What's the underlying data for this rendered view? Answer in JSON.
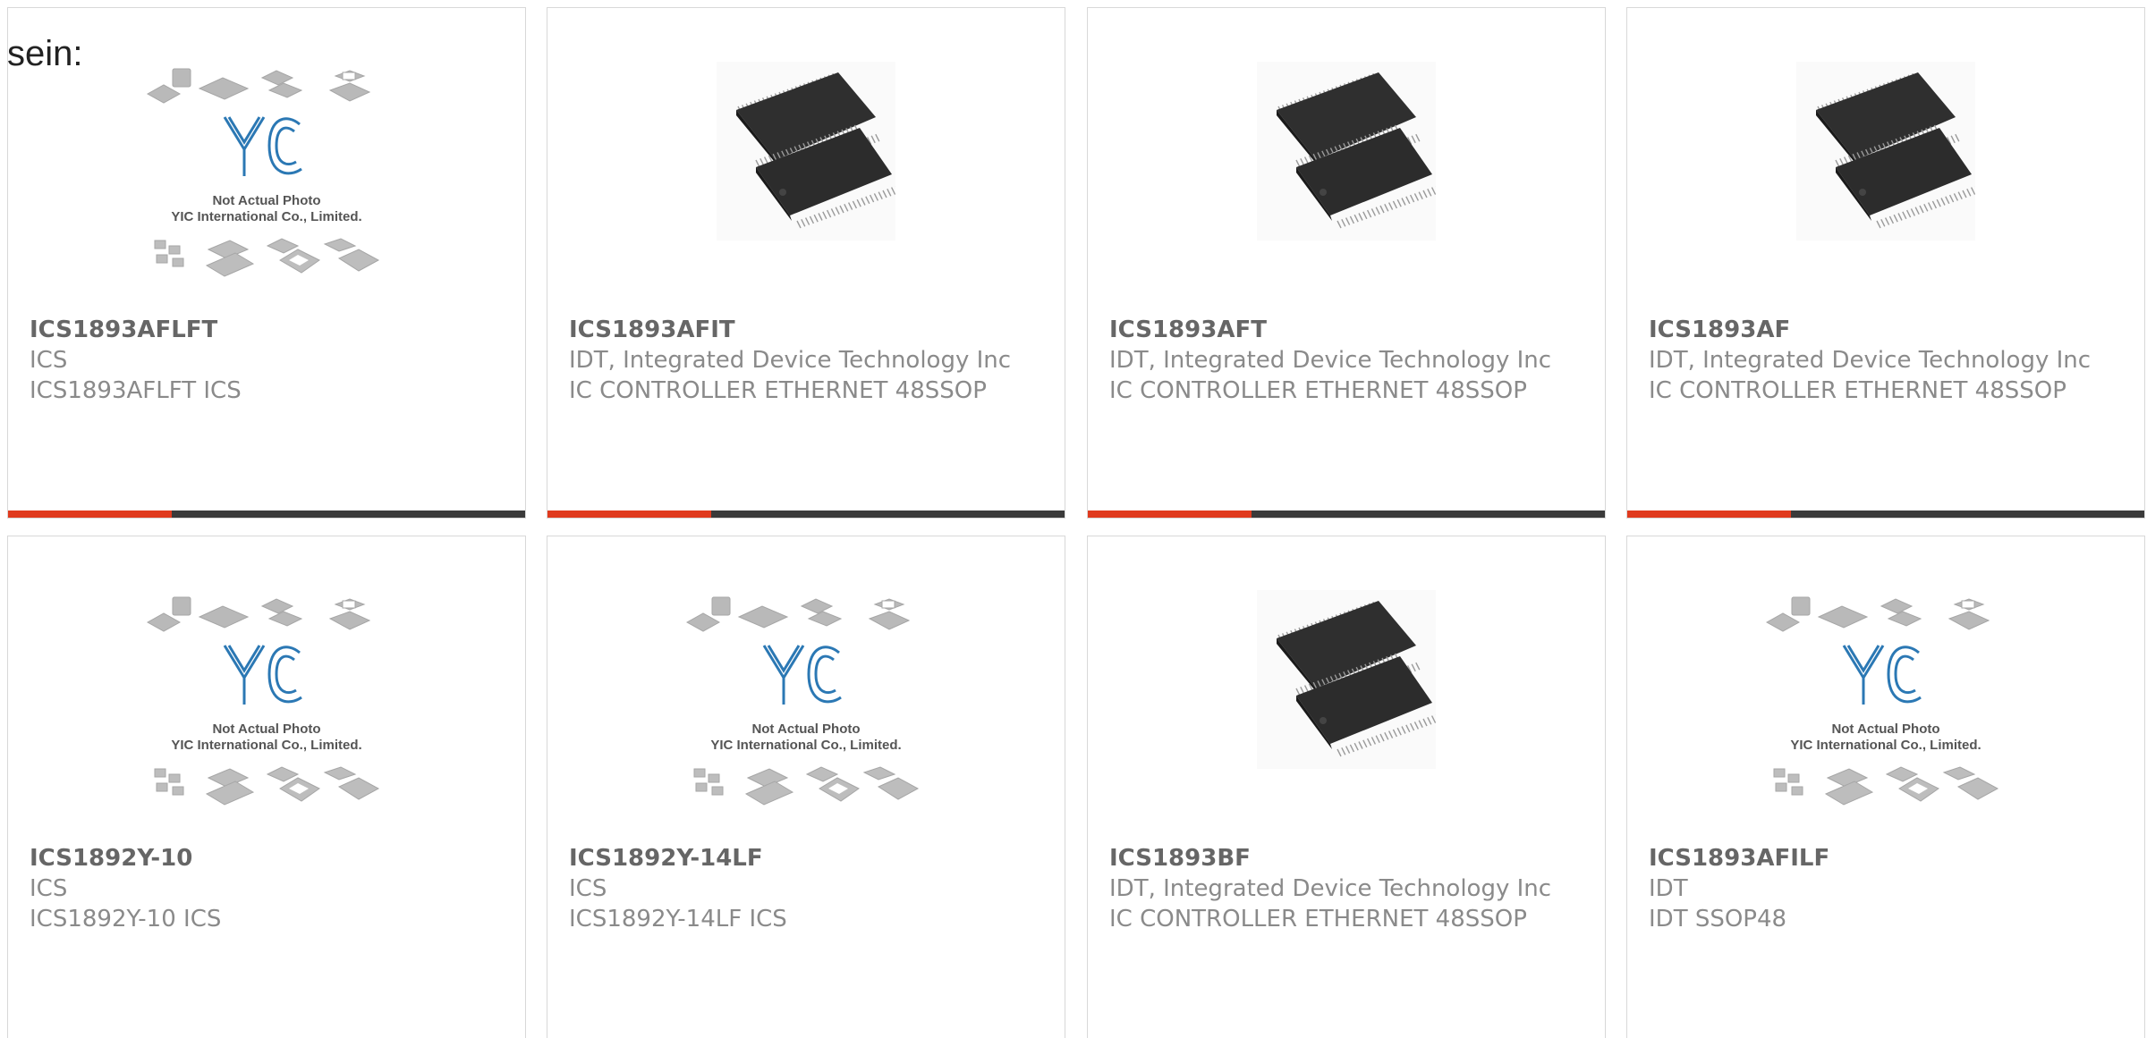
{
  "intro": "sein:",
  "colors": {
    "accent": "#e03a1e",
    "bar": "#3a3a3a",
    "logo_blue": "#2b78b4"
  },
  "placeholder_image": {
    "line1": "Not Actual Photo",
    "line2": "YIC International Co., Limited."
  },
  "products": [
    {
      "part": "ICS1893AFLFT",
      "maker": "ICS",
      "desc": "ICS1893AFLFT ICS",
      "image": "yic-placeholder-icon"
    },
    {
      "part": "ICS1893AFIT",
      "maker": "IDT, Integrated Device Technology Inc",
      "desc": "IC CONTROLLER ETHERNET 48SSOP",
      "image": "ssop-chip-icon"
    },
    {
      "part": "ICS1893AFT",
      "maker": "IDT, Integrated Device Technology Inc",
      "desc": "IC CONTROLLER ETHERNET 48SSOP",
      "image": "ssop-chip-icon"
    },
    {
      "part": "ICS1893AF",
      "maker": "IDT, Integrated Device Technology Inc",
      "desc": "IC CONTROLLER ETHERNET 48SSOP",
      "image": "ssop-chip-icon"
    },
    {
      "part": "ICS1892Y-10",
      "maker": "ICS",
      "desc": "ICS1892Y-10 ICS",
      "image": "yic-placeholder-icon"
    },
    {
      "part": "ICS1892Y-14LF",
      "maker": "ICS",
      "desc": "ICS1892Y-14LF ICS",
      "image": "yic-placeholder-icon"
    },
    {
      "part": "ICS1893BF",
      "maker": "IDT, Integrated Device Technology Inc",
      "desc": "IC CONTROLLER ETHERNET 48SSOP",
      "image": "ssop-chip-icon"
    },
    {
      "part": "ICS1893AFILF",
      "maker": "IDT",
      "desc": "IDT SSOP48",
      "image": "yic-placeholder-icon"
    }
  ]
}
